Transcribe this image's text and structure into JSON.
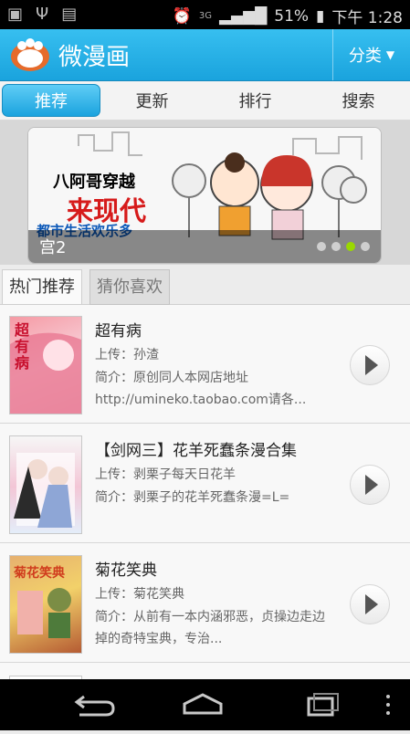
{
  "status_bar": {
    "network": "3G",
    "battery": "51%",
    "time": "下午 1:28",
    "icons": [
      "android-debug-icon",
      "usb-icon",
      "message-icon",
      "alarm-icon",
      "signal-icon",
      "battery-icon"
    ]
  },
  "app": {
    "title": "微漫画",
    "category_label": "分类",
    "accent": "#1aa3dd"
  },
  "tabs": [
    {
      "label": "推荐"
    },
    {
      "label": "更新"
    },
    {
      "label": "排行"
    },
    {
      "label": "搜索"
    }
  ],
  "banner": {
    "caption": "宫2",
    "headline_1": "八阿哥穿越",
    "headline_2": "来现代",
    "headline_3": "都市生活欢乐多",
    "slides": 4,
    "active_slide": 3
  },
  "subtabs": [
    {
      "label": "热门推荐"
    },
    {
      "label": "猜你喜欢"
    }
  ],
  "list": [
    {
      "title": "超有病",
      "uploader_label": "上传：",
      "uploader": "孙渣",
      "desc_label": "简介：",
      "desc": "原创同人本网店地址http://umineko.taobao.com请各...",
      "cover_text": "超有病"
    },
    {
      "title": "【剑网三】花羊死蠢条漫合集",
      "uploader_label": "上传：",
      "uploader": "剥栗子每天日花羊",
      "desc_label": "简介：",
      "desc": "剥栗子的花羊死蠢条漫=L=",
      "cover_text": ""
    },
    {
      "title": "菊花笑典",
      "uploader_label": "上传：",
      "uploader": "菊花笑典",
      "desc_label": "简介：",
      "desc": "从前有一本内涵邪恶，贞操边走边掉的奇特宝典，专治...",
      "cover_text": "菊花笑典"
    }
  ],
  "nav": {
    "icons": [
      "back-icon",
      "home-icon",
      "recent-apps-icon",
      "more-icon"
    ]
  }
}
